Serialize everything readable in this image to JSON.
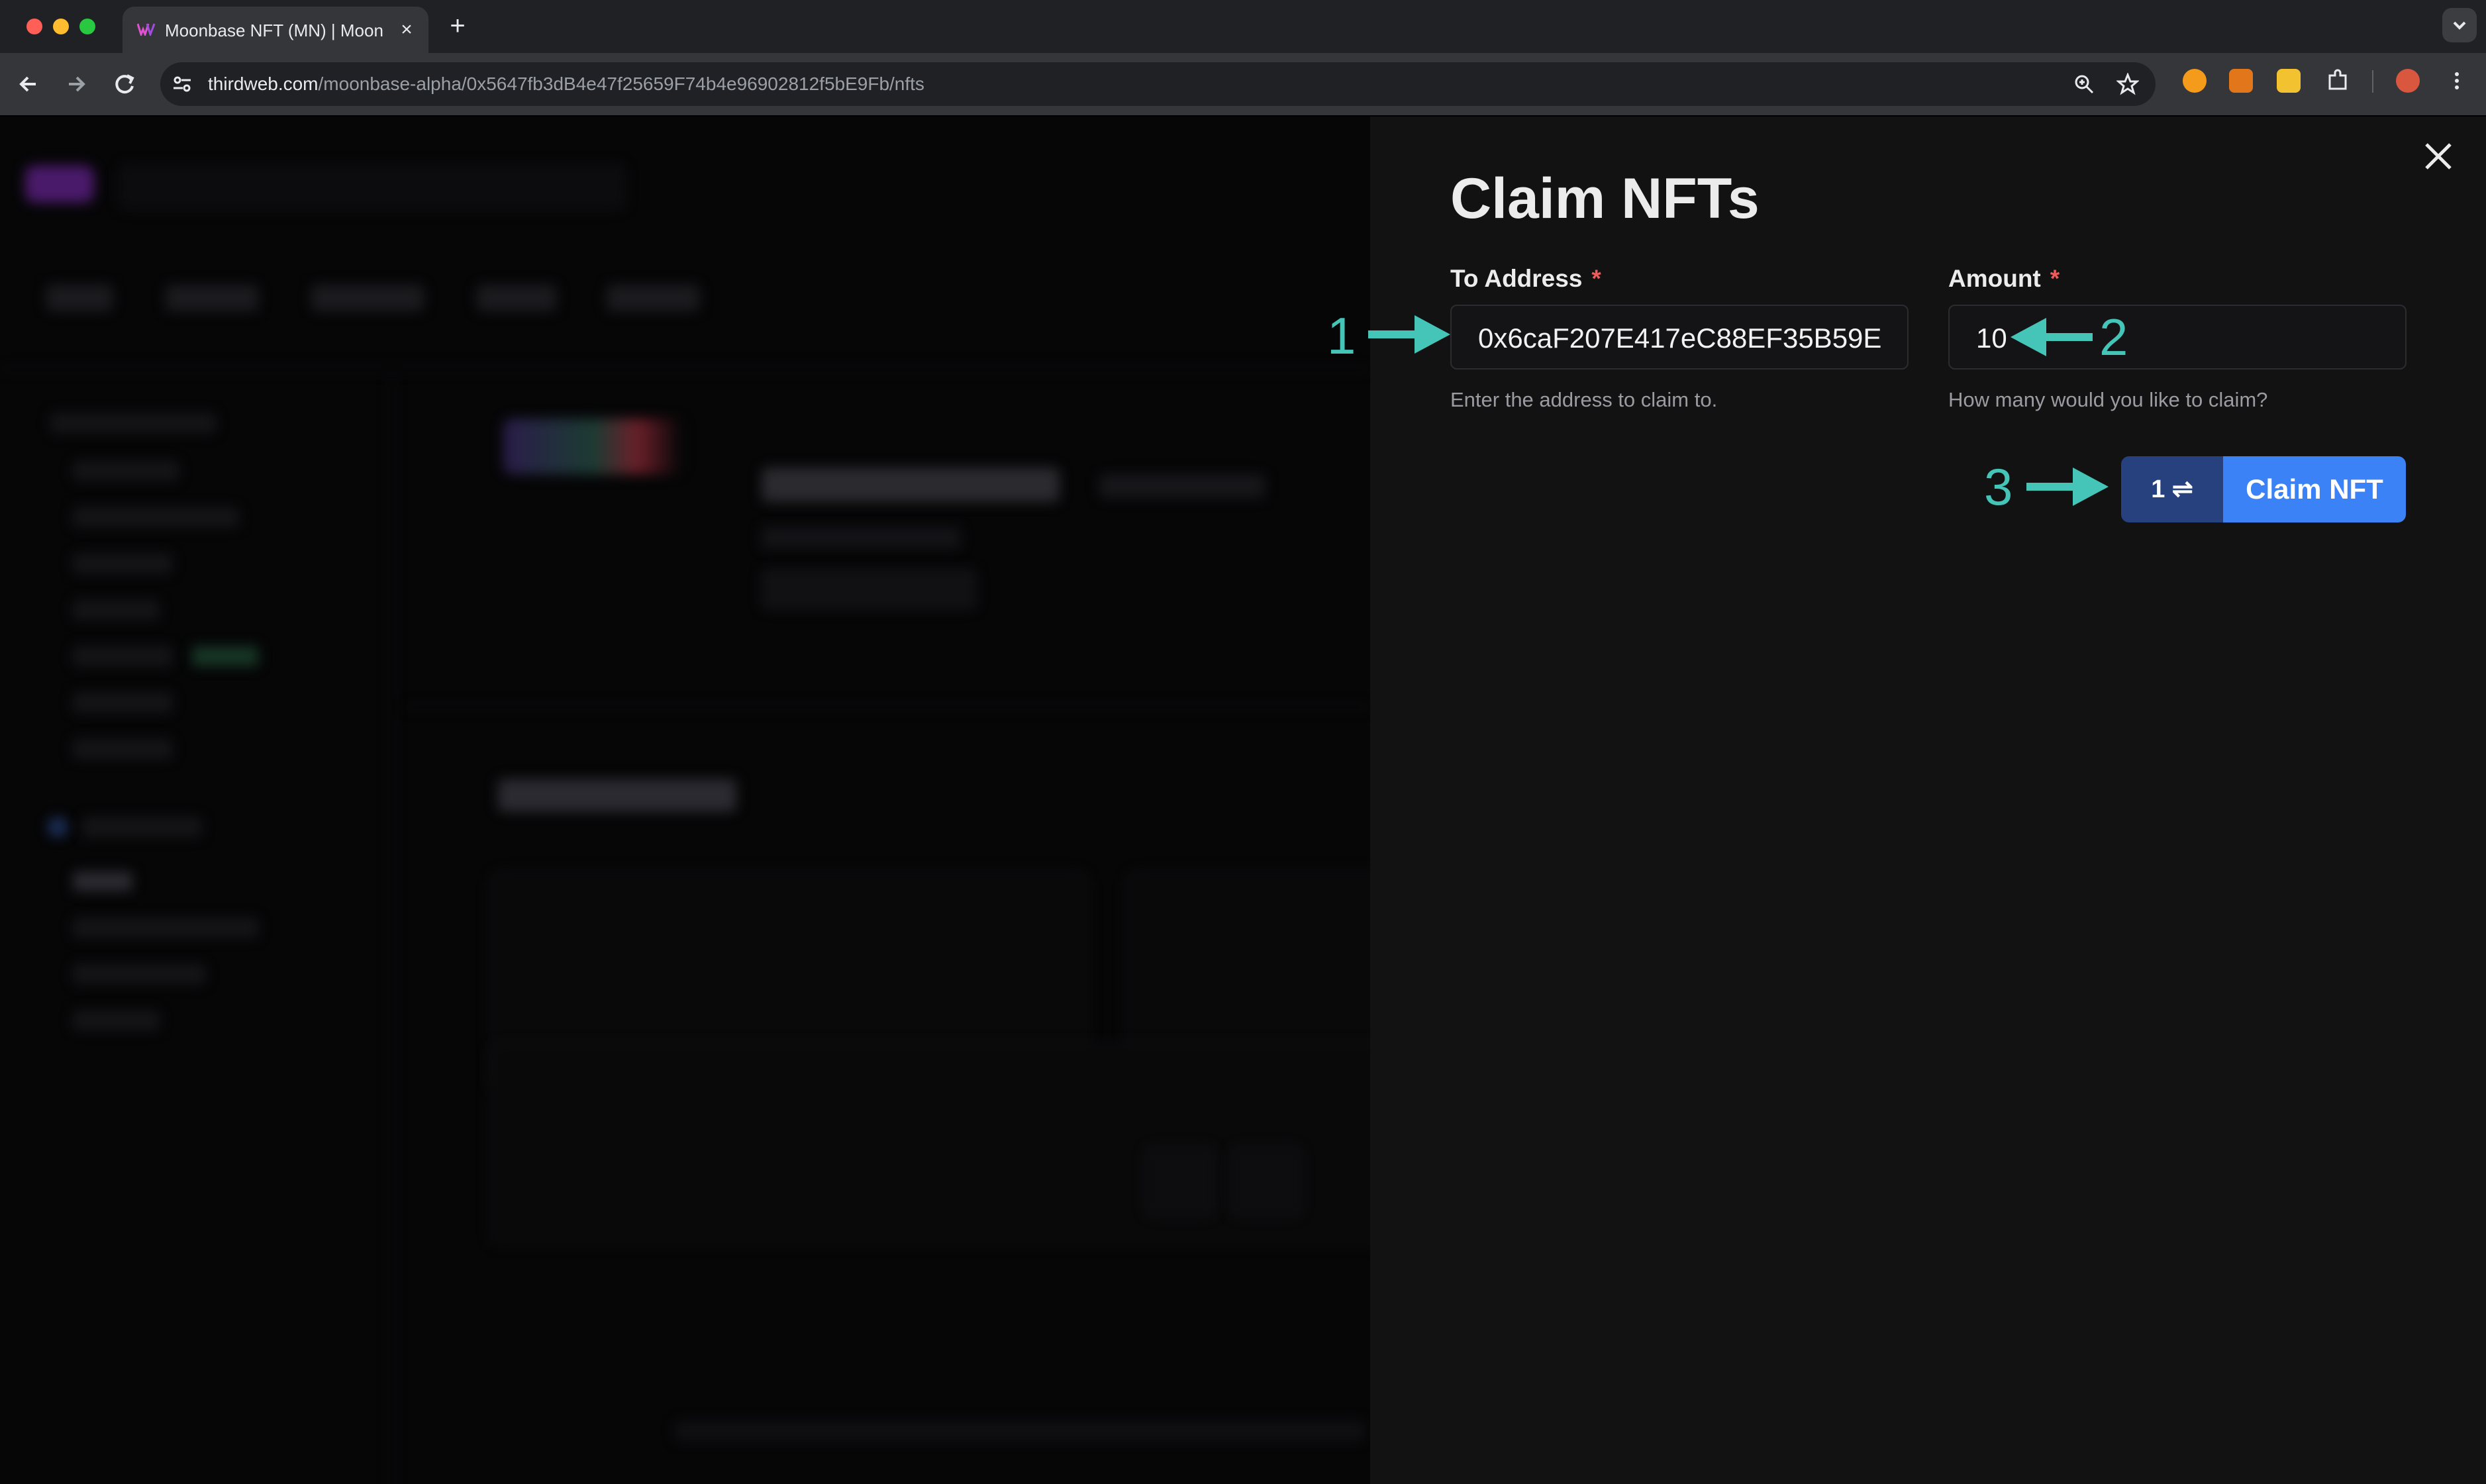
{
  "browser": {
    "tab_title": "Moonbase NFT (MN) | Moonb",
    "url_host": "thirdweb.com",
    "url_path": "/moonbase-alpha/0x5647fb3dB4e47f25659F74b4e96902812f5bE9Fb/nfts",
    "traffic_light_colors": [
      "#ff5f57",
      "#febc2e",
      "#28c840"
    ],
    "icons": [
      "back-icon",
      "forward-icon",
      "reload-icon",
      "site-info-icon",
      "zoom-icon",
      "bookmark-star-icon",
      "extension-puzzle-icon",
      "profile-avatar-icon",
      "kebab-menu-icon"
    ]
  },
  "drawer": {
    "title": "Claim NFTs",
    "to_address": {
      "label": "To Address",
      "required_marker": "*",
      "value": "0x6caF207E417eC88EF35B59E",
      "helper": "Enter the address to claim to."
    },
    "amount": {
      "label": "Amount",
      "required_marker": "*",
      "value": "10",
      "helper": "How many would you like to claim?"
    },
    "quantity_button": "1 ⇌",
    "submit_button": "Claim NFT",
    "colors": {
      "background": "#121212",
      "accent": "#3b82f6",
      "accent_dark": "#27407e",
      "required": "#ef5a5a"
    }
  },
  "annotations": {
    "step_1": "1",
    "step_2": "2",
    "step_3": "3",
    "color": "#45c4b8"
  }
}
